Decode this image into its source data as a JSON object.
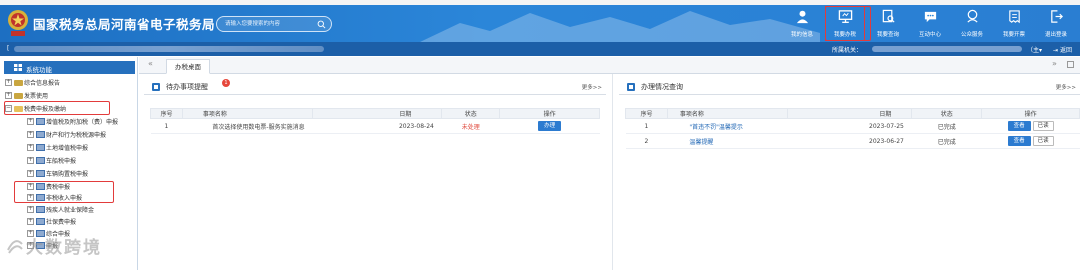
{
  "header": {
    "title": "国家税务总局河南省电子税务局",
    "search_placeholder": "请输入您要搜索的内容"
  },
  "nav": [
    {
      "label": "我的信息",
      "icon": "user-icon"
    },
    {
      "label": "我要办税",
      "icon": "monitor-icon",
      "highlighted": true
    },
    {
      "label": "我要查询",
      "icon": "search-doc-icon"
    },
    {
      "label": "互动中心",
      "icon": "chat-icon"
    },
    {
      "label": "公众服务",
      "icon": "people-icon"
    },
    {
      "label": "我要开票",
      "icon": "invoice-icon"
    },
    {
      "label": "退出登录",
      "icon": "logout-icon"
    }
  ],
  "infobar": {
    "left_mark": "[",
    "agency_label": "所属机关：",
    "main_label": "（主▾",
    "back_label": "返回"
  },
  "sidebar": {
    "title": "系统功能",
    "items": [
      {
        "label": "综合信息报告",
        "level": 0,
        "expanded": false
      },
      {
        "label": "发票使用",
        "level": 0,
        "expanded": false
      },
      {
        "label": "税费申报及缴纳",
        "level": 0,
        "expanded": true,
        "highlighted": true
      },
      {
        "label": "增值税及附加税（费）申报",
        "level": 1
      },
      {
        "label": "财产和行为税税源申报",
        "level": 1
      },
      {
        "label": "土地增值税申报",
        "level": 1
      },
      {
        "label": "车船税申报",
        "level": 1
      },
      {
        "label": "车辆购置税申报",
        "level": 1
      },
      {
        "label": "费税申报",
        "level": 1
      },
      {
        "label": "非税收入申报",
        "level": 1,
        "highlighted": true
      },
      {
        "label": "残疾人就业保障金",
        "level": 1
      },
      {
        "label": "社保费申报",
        "level": 1
      },
      {
        "label": "综合申报",
        "level": 1
      },
      {
        "label": "申报",
        "level": 1
      }
    ]
  },
  "tabs": {
    "prev": "«",
    "desk": "办税桌面",
    "next": "»"
  },
  "todo_panel": {
    "title": "待办事项提醒",
    "badge": "1",
    "more": "更多>>",
    "columns": [
      "序号",
      "事项名称",
      "日期",
      "状态",
      "操作"
    ],
    "rows": [
      {
        "no": "1",
        "name": "首次选择使用数电票-服务实施消息",
        "date": "2023-08-24",
        "status": "未处理",
        "action": "办理"
      }
    ]
  },
  "done_panel": {
    "title": "办理情况查询",
    "more": "更多>>",
    "columns": [
      "序号",
      "事项名称",
      "日期",
      "状态",
      "操作"
    ],
    "rows": [
      {
        "no": "1",
        "name": "\"首违不罚\"温馨提示",
        "date": "2023-07-25",
        "status": "已完成",
        "view": "查看",
        "read": "已读"
      },
      {
        "no": "2",
        "name": "温馨提醒",
        "date": "2023-06-27",
        "status": "已完成",
        "view": "查看",
        "read": "已读"
      }
    ]
  },
  "watermark": "大数跨境",
  "colors": {
    "header_blue": "#2b86d9",
    "infobar_blue": "#1c5fa8",
    "highlight_red": "#e23b3b",
    "status_red": "#e0483b",
    "button_blue": "#2c7bd0"
  }
}
